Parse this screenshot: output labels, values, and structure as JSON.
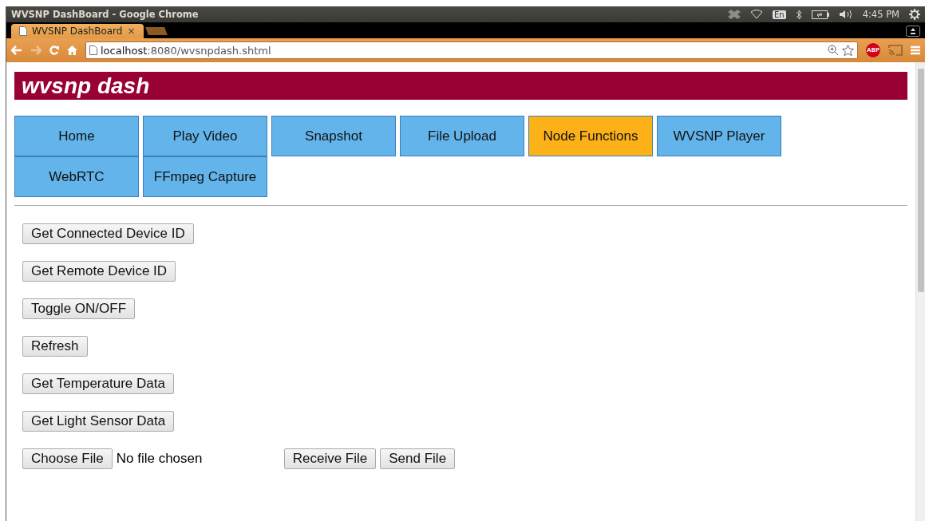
{
  "window": {
    "title": "WVSNP DashBoard - Google Chrome"
  },
  "system_tray": {
    "keyboard_layout": "En",
    "time": "4:45 PM"
  },
  "tabs": [
    {
      "label": "WVSNP DashBoard",
      "close": "×",
      "selected": true
    }
  ],
  "address_bar": {
    "host": "localhost",
    "path": ":8080/wvsnpdash.shtml"
  },
  "extension_badge": "ABP",
  "page": {
    "header": "wvsnp dash",
    "nav": [
      {
        "label": "Home",
        "selected": false
      },
      {
        "label": "Play Video",
        "selected": false
      },
      {
        "label": "Snapshot",
        "selected": false
      },
      {
        "label": "File Upload",
        "selected": false
      },
      {
        "label": "Node Functions",
        "selected": true
      },
      {
        "label": "WVSNP Player",
        "selected": false
      },
      {
        "label": "WebRTC",
        "selected": false
      },
      {
        "label": "FFmpeg Capture",
        "selected": false
      }
    ],
    "buttons": [
      "Get Connected Device ID",
      "Get Remote Device ID",
      "Toggle ON/OFF",
      "Refresh",
      "Get Temperature Data",
      "Get Light Sensor Data"
    ],
    "file_row": {
      "choose_button": "Choose File",
      "file_status": "No file chosen",
      "actions": [
        "Receive File",
        "Send File"
      ]
    }
  }
}
